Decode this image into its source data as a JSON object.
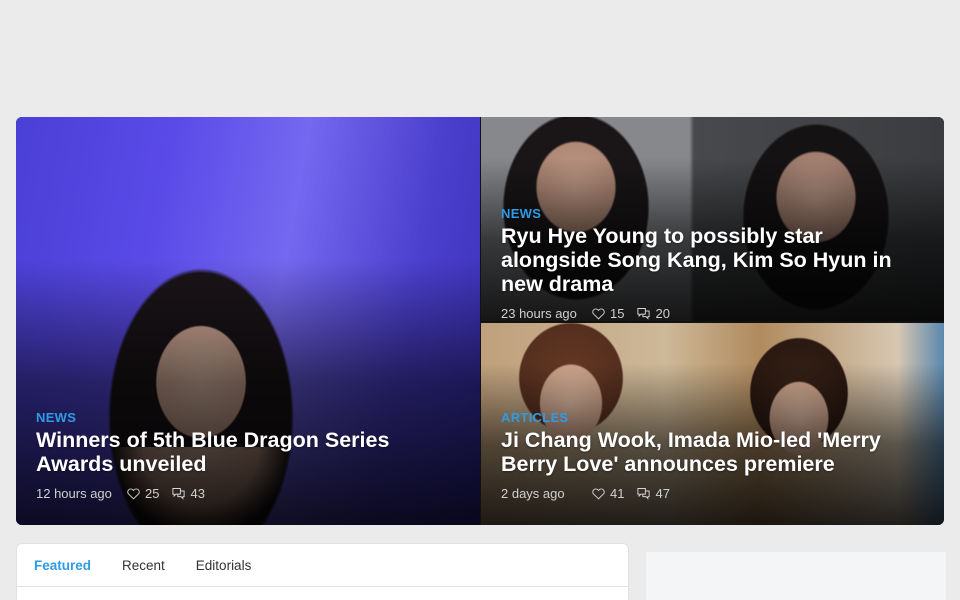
{
  "hero": {
    "main": {
      "category": "NEWS",
      "title": "Winners of 5th Blue Dragon Series Awards unveiled",
      "time": "12 hours ago",
      "likes": "25",
      "comments": "43"
    },
    "top_right": {
      "category": "NEWS",
      "title": "Ryu Hye Young to possibly star alongside Song Kang, Kim So Hyun in new drama",
      "time": "23 hours ago",
      "likes": "15",
      "comments": "20"
    },
    "bottom_right": {
      "category": "ARTICLES",
      "title": "Ji Chang Wook, Imada Mio-led 'Merry Berry Love' announces premiere",
      "time": "2 days ago",
      "likes": "41",
      "comments": "47"
    }
  },
  "tabs": {
    "items": [
      {
        "label": "Featured",
        "active": true
      },
      {
        "label": "Recent",
        "active": false
      },
      {
        "label": "Editorials",
        "active": false
      }
    ]
  },
  "colors": {
    "accent": "#2f9be6",
    "background": "#ebebec"
  },
  "icons": {
    "like": "heart-icon",
    "comment": "comments-icon"
  }
}
